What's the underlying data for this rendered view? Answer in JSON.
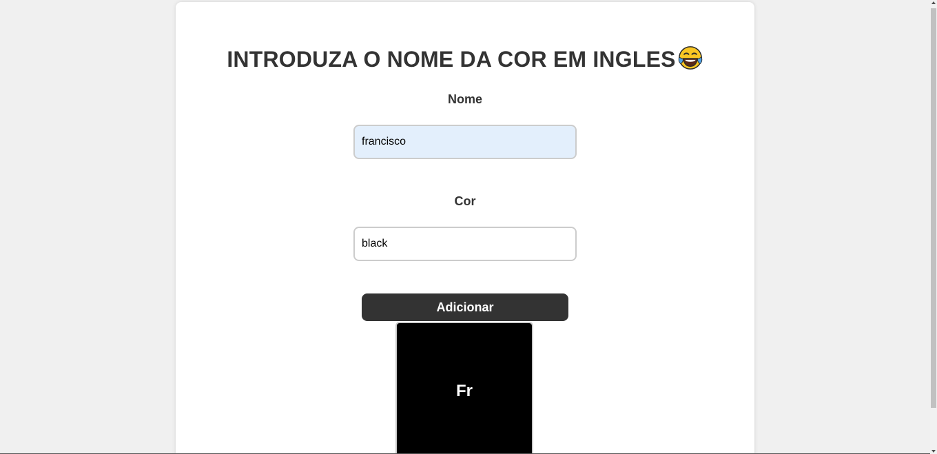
{
  "header": {
    "title": "INTRODUZA O NOME DA COR EM INGLES",
    "title_emoji": "laughing-tears-emoji-icon"
  },
  "form": {
    "name_label": "Nome",
    "name_value": "francisco",
    "color_label": "Cor",
    "color_value": "black",
    "submit_label": "Adicionar"
  },
  "result": {
    "swatch_color": "#000000",
    "swatch_text": "Fr"
  },
  "colors": {
    "background": "#f0f0f0",
    "card": "#ffffff",
    "text": "#333333",
    "button": "#333333",
    "autofill": "#e3effc"
  }
}
